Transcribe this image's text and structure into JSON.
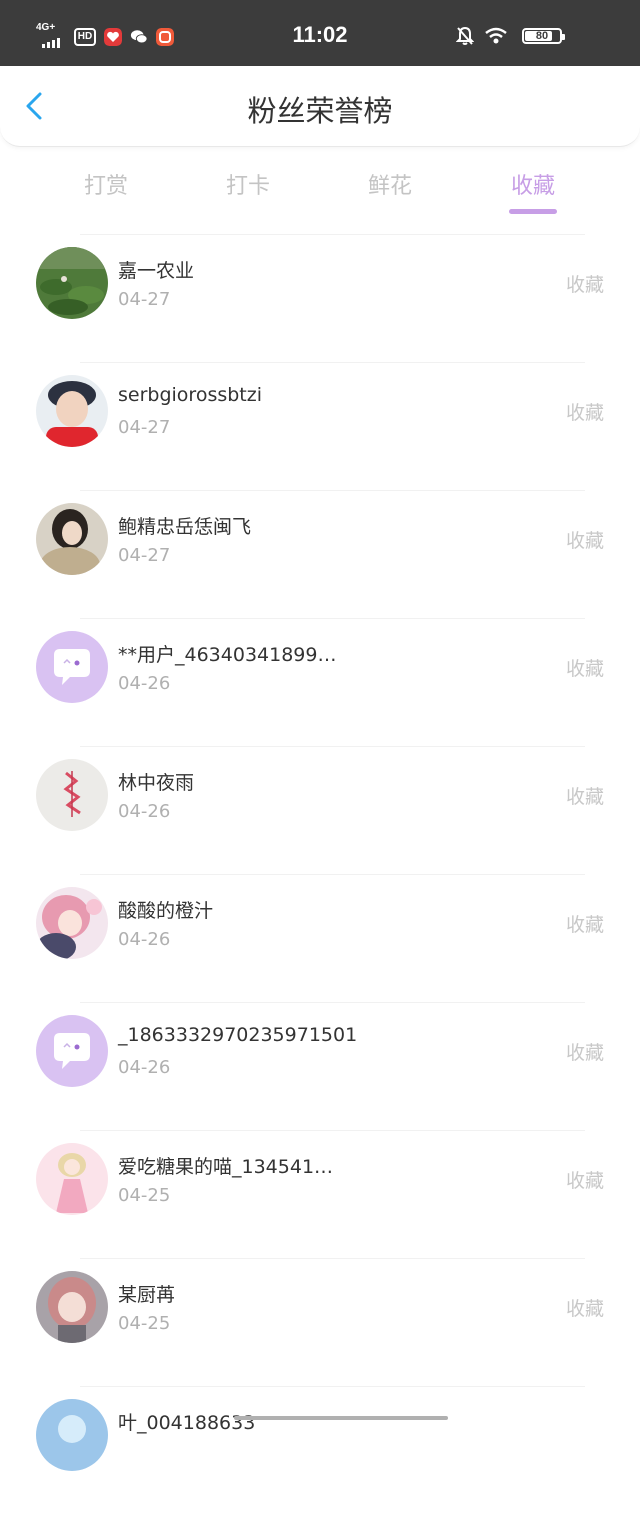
{
  "status_bar": {
    "network": "4G+",
    "hd": "HD",
    "time": "11:02",
    "battery": "80",
    "battery_level": 0.8
  },
  "header": {
    "title": "粉丝荣誉榜"
  },
  "tabs": [
    {
      "label": "打赏",
      "active": false
    },
    {
      "label": "打卡",
      "active": false
    },
    {
      "label": "鲜花",
      "active": false
    },
    {
      "label": "收藏",
      "active": true
    }
  ],
  "colors": {
    "accent": "#c79ee6",
    "status_bar_bg": "#3c3c3c"
  },
  "fans": [
    {
      "name": "嘉一农业",
      "date": "04-27",
      "action": "收藏",
      "avatar": "lotus-pond-photo"
    },
    {
      "name": "serbgiorossbtzi",
      "date": "04-27",
      "action": "收藏",
      "avatar": "child-portrait-photo"
    },
    {
      "name": "鲍精忠岳恁闽飞",
      "date": "04-27",
      "action": "收藏",
      "avatar": "woman-fur-coat-photo"
    },
    {
      "name": "**用户_46340341899…",
      "date": "04-26",
      "action": "收藏",
      "avatar": "default-chat-bubble-avatar"
    },
    {
      "name": "林中夜雨",
      "date": "04-26",
      "action": "收藏",
      "avatar": "red-embroidery-photo"
    },
    {
      "name": "酸酸的橙汁",
      "date": "04-26",
      "action": "收藏",
      "avatar": "anime-girl-pink-avatar"
    },
    {
      "name": "_1863332970235971501",
      "date": "04-26",
      "action": "收藏",
      "avatar": "default-chat-bubble-avatar"
    },
    {
      "name": "爱吃糖果的喵_134541…",
      "date": "04-25",
      "action": "收藏",
      "avatar": "anime-girl-dress-avatar"
    },
    {
      "name": "某厨苒",
      "date": "04-25",
      "action": "收藏",
      "avatar": "anime-girl-brown-hair-avatar"
    },
    {
      "name": "叶_004188633",
      "date": "",
      "action": "",
      "avatar": "blue-sky-avatar"
    }
  ]
}
